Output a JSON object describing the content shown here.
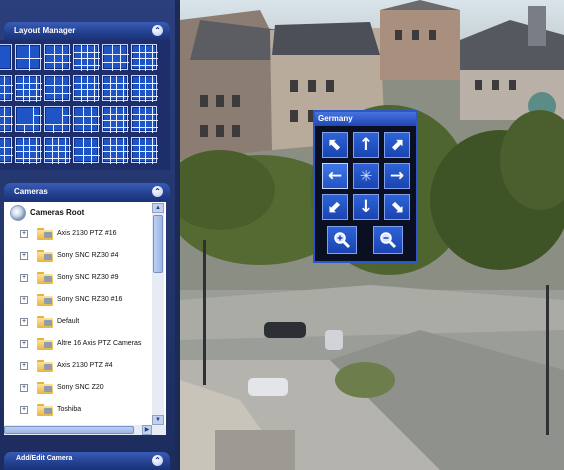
{
  "layout_manager": {
    "title": "Layout Manager",
    "collapse_icon": "chevron-up-circle-icon",
    "layouts": [
      "1x1",
      "2x2",
      "3x3",
      "4x4",
      "3x3",
      "4x4",
      "3x3",
      "4x4",
      "3x3",
      "4x4",
      "4x4",
      "4x4",
      "3x3",
      "1+5",
      "1+5",
      "3x3",
      "4x4",
      "4x4",
      "3x3",
      "4x4",
      "4x4",
      "3x3",
      "4x4",
      "4x4"
    ]
  },
  "cameras": {
    "title": "Cameras",
    "collapse_icon": "chevron-up-circle-icon",
    "root_label": "Cameras Root",
    "items": [
      "Axis 2130 PTZ #16",
      "Sony SNC RZ30 #4",
      "Sony SNC RZ30 #9",
      "Sony SNC RZ30 #16",
      "Default",
      "Altre 16 Axis PTZ Cameras",
      "Axis 2130 PTZ #4",
      "Sony SNC Z20",
      "Toshiba"
    ]
  },
  "bottom_panel": {
    "title": "Add/Edit Camera"
  },
  "ptz": {
    "title": "Germany",
    "buttons": {
      "up_left": "⬉",
      "up": "↑",
      "up_right": "⬈",
      "left": "←",
      "home": "✳",
      "right": "→",
      "down_left": "⬋",
      "down": "↓",
      "down_right": "⬊",
      "zoom_in": "🔍+",
      "zoom_out": "🔍-"
    }
  },
  "colors": {
    "accent": "#2b57c7",
    "panel_bg": "#1c2c5e",
    "tile_blue": "#1f54c7"
  }
}
